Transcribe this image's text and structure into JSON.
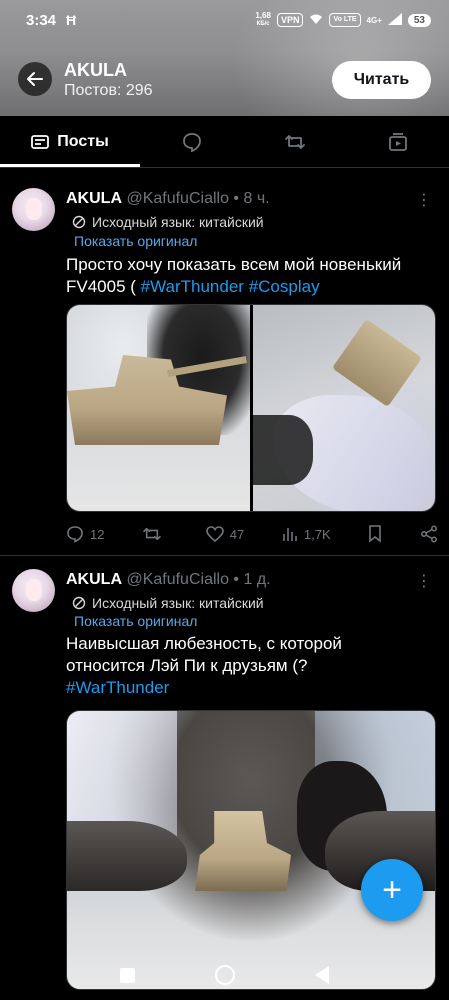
{
  "status_bar": {
    "time": "3:34",
    "speed_value": "1,68",
    "speed_unit": "КБ/с",
    "vpn": "VPN",
    "volte": "Vo LTE",
    "network": "4G+",
    "battery": "53"
  },
  "profile": {
    "name": "AKULA",
    "posts_count": "Постов: 296",
    "follow_label": "Читать"
  },
  "tabs": [
    {
      "label": "Посты",
      "icon": "posts-icon"
    },
    {
      "label": "",
      "icon": "replies-icon"
    },
    {
      "label": "",
      "icon": "retweet-icon"
    },
    {
      "label": "",
      "icon": "media-icon"
    }
  ],
  "posts": [
    {
      "name": "AKULA",
      "handle": "@KafufuCiallo",
      "time": "• 8 ч.",
      "translate_note": "Исходный язык: китайский",
      "show_original": "Показать оригинал",
      "text": "Просто хочу показать всем мой новенький FV4005 ( ",
      "hashtags": [
        "#WarThunder",
        "#Cosplay"
      ],
      "replies": "12",
      "retweets": "",
      "likes": "47",
      "views": "1,7K"
    },
    {
      "name": "AKULA",
      "handle": "@KafufuCiallo",
      "time": "• 1 д.",
      "translate_note": "Исходный язык: китайский",
      "show_original": "Показать оригинал",
      "text": "Наивысшая любезность, с которой относится Лэй Пи к друзьям (?",
      "hashtags": [
        "#WarThunder"
      ]
    }
  ],
  "fab": {
    "label": "+"
  },
  "colors": {
    "accent": "#1d9bf0",
    "background": "#000000",
    "muted": "#71767b"
  }
}
